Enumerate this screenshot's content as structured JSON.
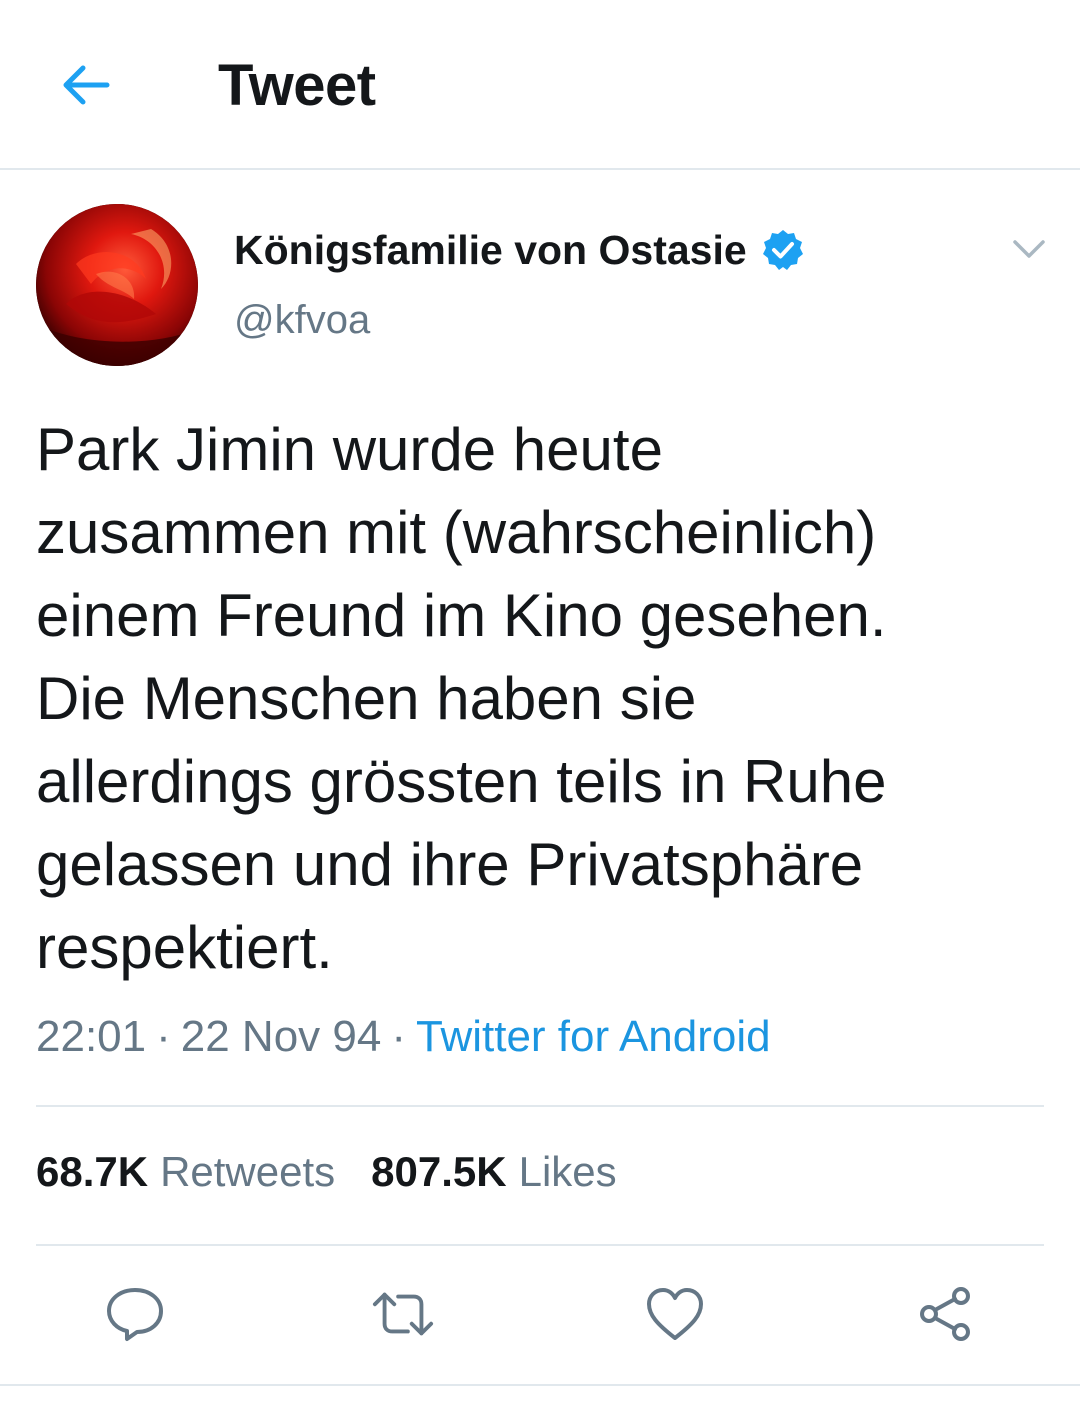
{
  "header": {
    "title": "Tweet",
    "back_icon": "arrow-left-icon",
    "accent_color": "#1da1f2"
  },
  "tweet": {
    "author": {
      "display_name": "Königsfamilie von Ostasie",
      "handle": "@kfvoa",
      "verified": true,
      "avatar_icon": "red-rose-avatar"
    },
    "text": "Park Jimin wurde heute\nzusammen mit (wahrscheinlich)\neinem Freund im Kino gesehen.\nDie Menschen haben sie\nallerdings grössten teils in Ruhe\ngelassen und ihre Privatsphäre\nrespektiert.",
    "time": "22:01",
    "date": "22 Nov 94",
    "separator": "·",
    "source": "Twitter for Android",
    "stats": {
      "retweets_count": "68.7K",
      "retweets_label": "Retweets",
      "likes_count": "807.5K",
      "likes_label": "Likes"
    },
    "actions": [
      {
        "name": "reply",
        "icon": "reply-icon"
      },
      {
        "name": "retweet",
        "icon": "retweet-icon"
      },
      {
        "name": "like",
        "icon": "heart-icon"
      },
      {
        "name": "share",
        "icon": "share-icon"
      }
    ]
  },
  "colors": {
    "text_primary": "#14171a",
    "text_secondary": "#657786",
    "link": "#1b95e0",
    "verified": "#1da1f2",
    "divider": "#e1e8ed"
  }
}
